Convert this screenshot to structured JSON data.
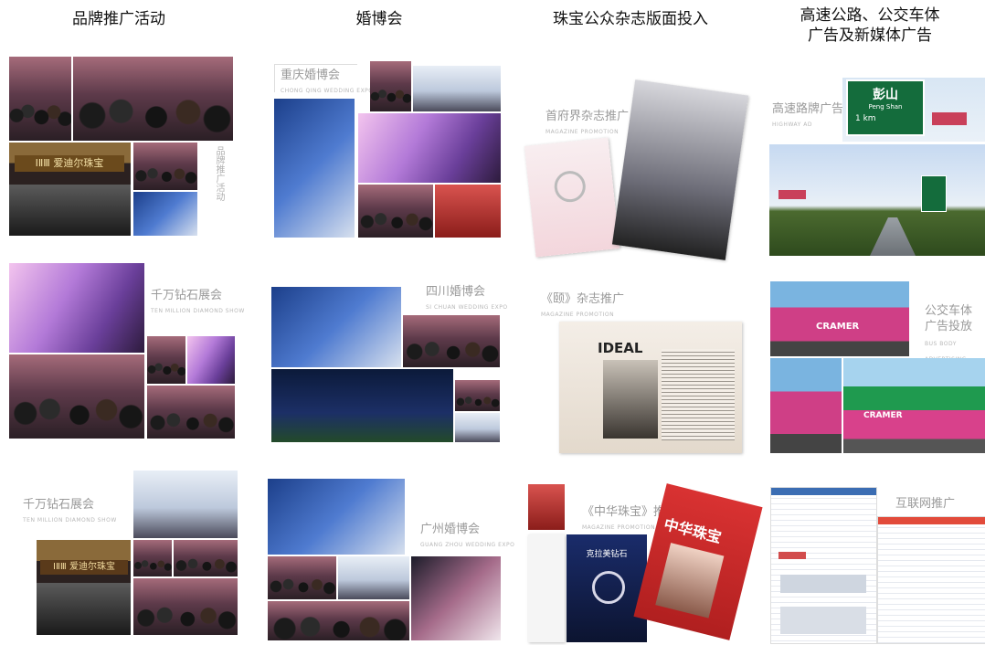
{
  "columns": [
    {
      "title": [
        "品牌推广活动"
      ]
    },
    {
      "title": [
        "婚博会"
      ]
    },
    {
      "title": [
        "珠宝公众杂志版面投入"
      ]
    },
    {
      "title": [
        "高速公路、公交车体",
        "广告及新媒体广告"
      ]
    }
  ],
  "labels": {
    "chongqing": "重庆婚博会",
    "sichuan": "四川婚博会",
    "guangzhou": "广州婚博会",
    "qianwan1": "千万钻石展会",
    "qianwan2": "千万钻石展会",
    "magazine_world": "首府界杂志推广",
    "magazine_ideal": "《颐》杂志推广",
    "magazine_china": "《中华珠宝》推广",
    "highway": "高速路牌广告",
    "bus": "公交车体广告投放",
    "web": "互联网推广"
  },
  "signs": {
    "store": "ⅠⅡⅢ 爱迪尔珠宝",
    "highway_place": "彭山",
    "highway_pinyin": "Peng Shan",
    "highway_dist": "1 km",
    "bus_brand": "CRAMER",
    "mag_ideal": "IDEAL",
    "mag_china": "中华珠宝",
    "mag_diamond": "克拉美钻石"
  }
}
